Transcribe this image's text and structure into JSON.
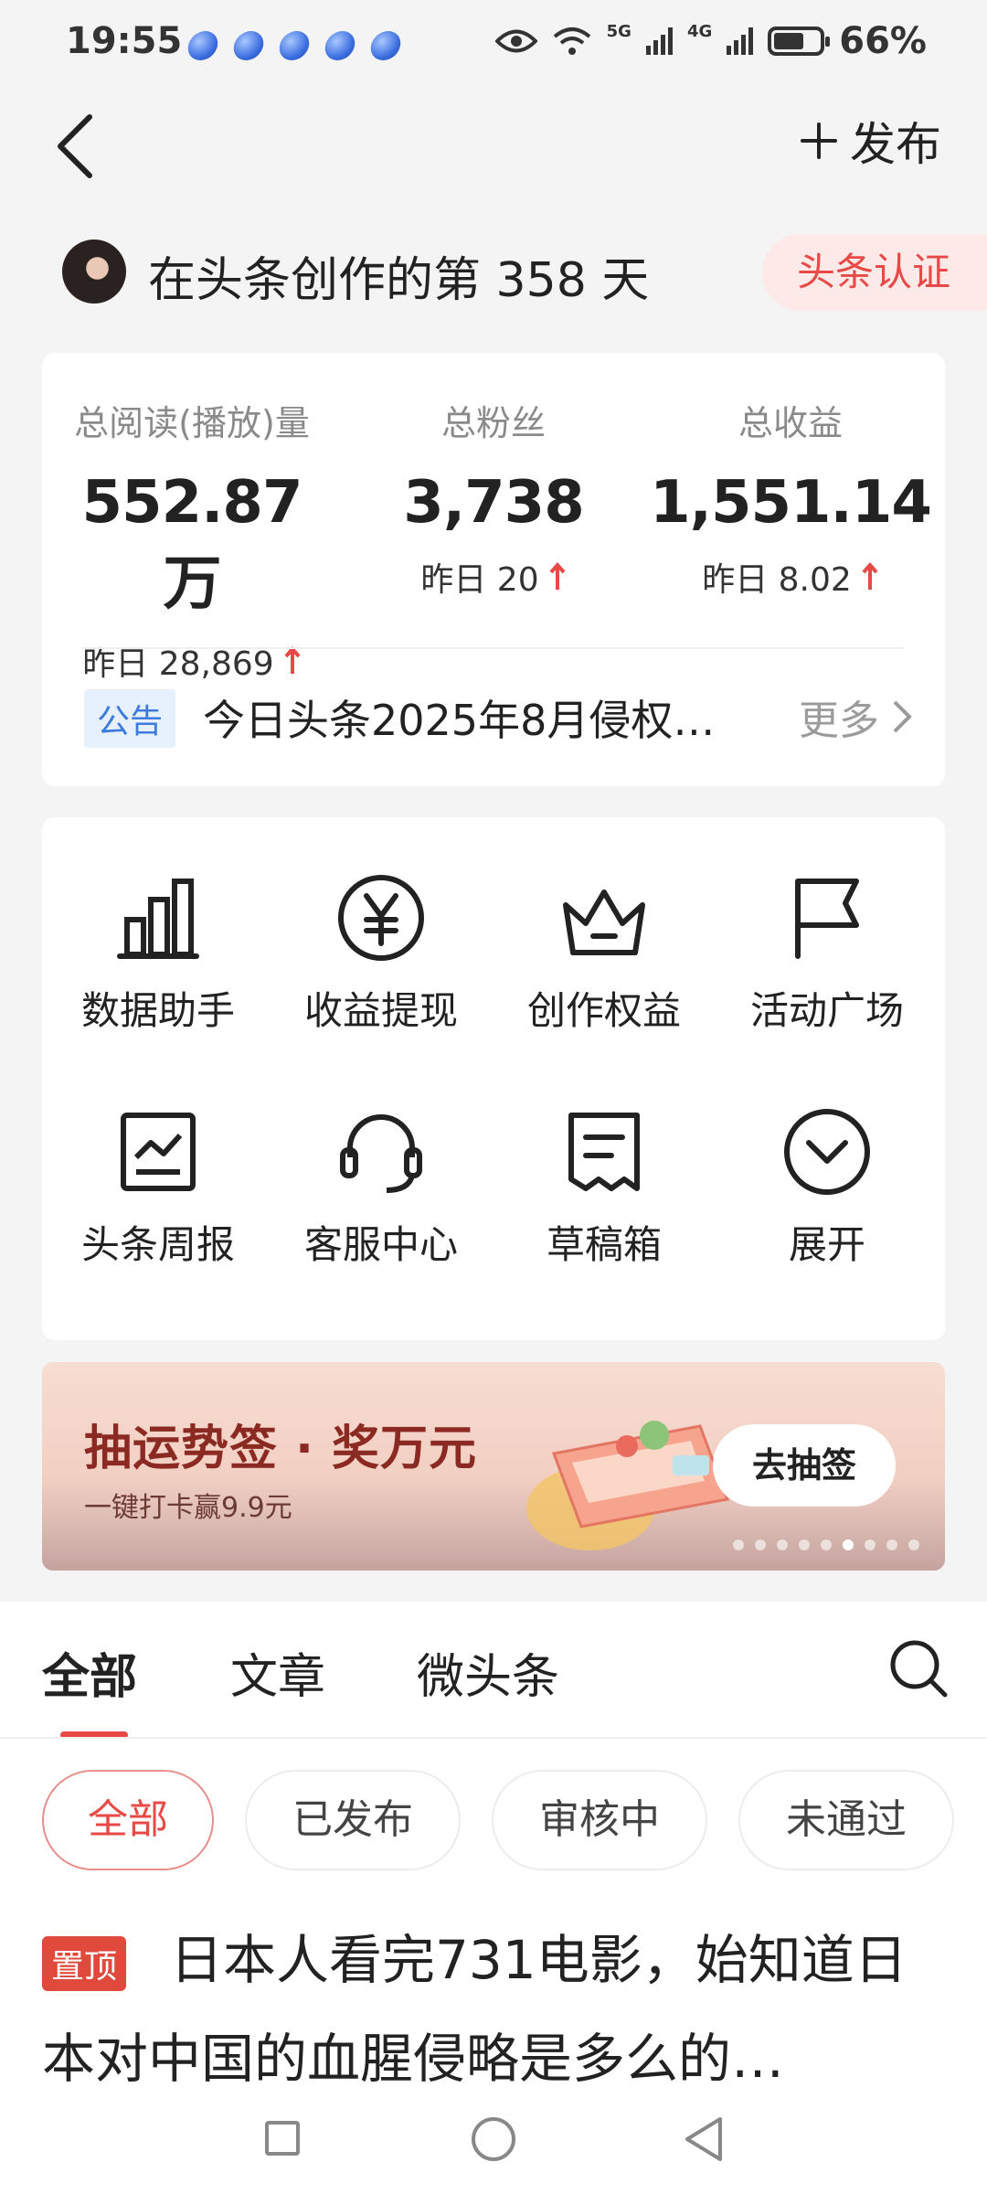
{
  "status_bar": {
    "time": "19:55",
    "notification_count": 5,
    "network_5g": "5G",
    "network_4g": "4G",
    "battery_pct": "66%",
    "battery_level": 0.66
  },
  "header": {
    "publish_label": "发布"
  },
  "creator": {
    "days_text": "在头条创作的第 358 天",
    "cert_label": "头条认证"
  },
  "stats": {
    "items": [
      {
        "label": "总阅读(播放)量",
        "value": "552.87万",
        "delta": "昨日 28,869"
      },
      {
        "label": "总粉丝",
        "value": "3,738",
        "delta": "昨日 20"
      },
      {
        "label": "总收益",
        "value": "1,551.14",
        "delta": "昨日 8.02"
      }
    ],
    "notice_tag": "公告",
    "notice_text": "今日头条2025年8月侵权…",
    "notice_more": "更多"
  },
  "tools": [
    {
      "label": "数据助手",
      "icon": "bar-chart-icon"
    },
    {
      "label": "收益提现",
      "icon": "yuan-icon"
    },
    {
      "label": "创作权益",
      "icon": "crown-icon"
    },
    {
      "label": "活动广场",
      "icon": "flag-icon"
    },
    {
      "label": "头条周报",
      "icon": "report-icon"
    },
    {
      "label": "客服中心",
      "icon": "headset-icon"
    },
    {
      "label": "草稿箱",
      "icon": "draft-icon"
    },
    {
      "label": "展开",
      "icon": "expand-icon"
    }
  ],
  "banner": {
    "title": "抽运势签 · 奖万元",
    "subtitle": "一键打卡赢9.9元",
    "button": "去抽签",
    "dots_total": 9,
    "dots_active_index": 5
  },
  "tabs": [
    "全部",
    "文章",
    "微头条"
  ],
  "filters": [
    "全部",
    "已发布",
    "审核中",
    "未通过"
  ],
  "article": {
    "tag": "置顶",
    "title": "日本人看完731电影，始知道日本对中国的血腥侵略是多么的…"
  },
  "colors": {
    "accent": "#e74a46",
    "notice_blue": "#3d7bdc"
  }
}
